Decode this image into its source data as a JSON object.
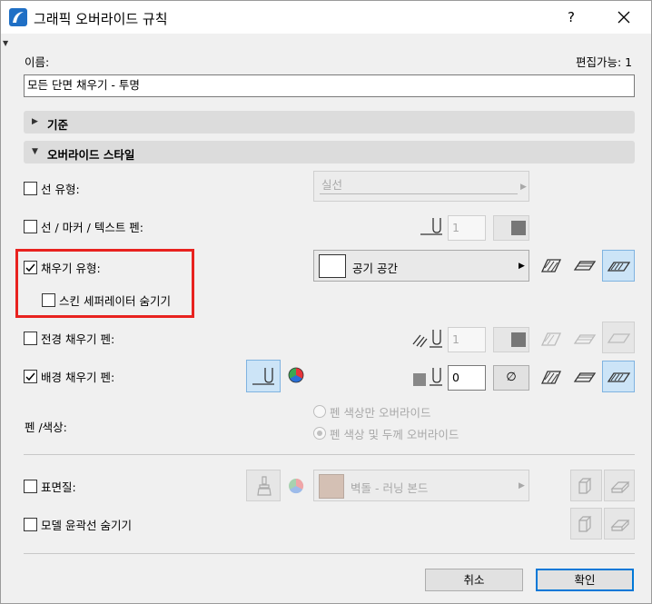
{
  "window": {
    "title": "그래픽 오버라이드 규칙",
    "help_label": "?",
    "close_label": "✕"
  },
  "name": {
    "label": "이름:",
    "editable_label": "편집가능: 1",
    "value": "모든 단면 채우기 - 투명"
  },
  "sections": {
    "criteria": "기준",
    "override_style": "오버라이드 스타일"
  },
  "line_type": {
    "label": "선 유형:",
    "checked": false,
    "value": "실선"
  },
  "line_marker_text_pen": {
    "label": "선 / 마커 / 텍스트 펜:",
    "checked": false,
    "pen_value": "1"
  },
  "fill_type": {
    "label": "채우기 유형:",
    "checked": true,
    "value": "공기 공간",
    "hide_skin_separator": {
      "label": "스킨 세퍼레이터 숨기기",
      "checked": false
    }
  },
  "foreground_pen": {
    "label": "전경 채우기 펜:",
    "checked": false,
    "pen_value": "1"
  },
  "background_pen": {
    "label": "배경 채우기 펜:",
    "checked": true,
    "pen_value": "0",
    "transparent_symbol": "∅"
  },
  "pen_color": {
    "label": "펜 /색상:",
    "options": [
      "펜 색상만 오버라이드",
      "펜 색상 및 두께 오버라이드"
    ],
    "selected": "펜 색상 및 두께 오버라이드"
  },
  "surface": {
    "label": "표면질:",
    "checked": false,
    "value": "벽돌 - 러닝 본드",
    "swatch_color": "#d4c0b4"
  },
  "hide_model_contours": {
    "label": "모델 윤곽선 숨기기",
    "checked": false
  },
  "buttons": {
    "cancel": "취소",
    "ok": "확인"
  },
  "colors": {
    "highlight_box": "#e8221f",
    "selected_button": "#cce4f7",
    "default_button_border": "#0078d7"
  }
}
